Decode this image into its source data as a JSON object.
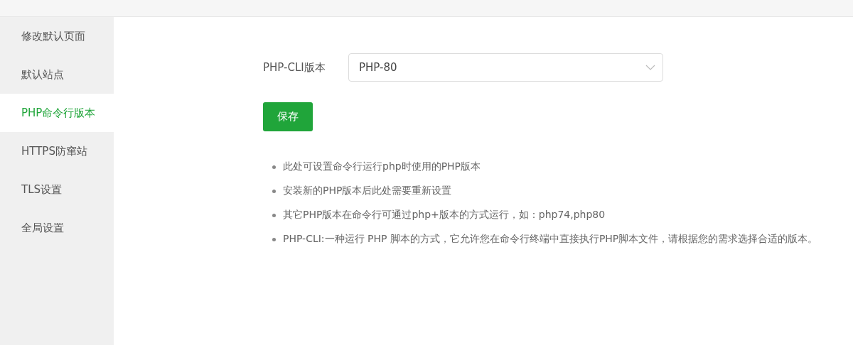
{
  "sidebar": {
    "items": [
      {
        "label": "修改默认页面",
        "selected": false
      },
      {
        "label": "默认站点",
        "selected": false
      },
      {
        "label": "PHP命令行版本",
        "selected": true
      },
      {
        "label": "HTTPS防窜站",
        "selected": false
      },
      {
        "label": "TLS设置",
        "selected": false
      },
      {
        "label": "全局设置",
        "selected": false
      }
    ]
  },
  "form": {
    "label": "PHP-CLI版本",
    "select_value": "PHP-80",
    "save_button": "保存"
  },
  "notes": [
    "此处可设置命令行运行php时使用的PHP版本",
    "安装新的PHP版本后此处需要重新设置",
    "其它PHP版本在命令行可通过php+版本的方式运行，如：php74,php80",
    "PHP-CLI:一种运行 PHP 脚本的方式，它允许您在命令行终端中直接执行PHP脚本文件，请根据您的需求选择合适的版本。"
  ]
}
